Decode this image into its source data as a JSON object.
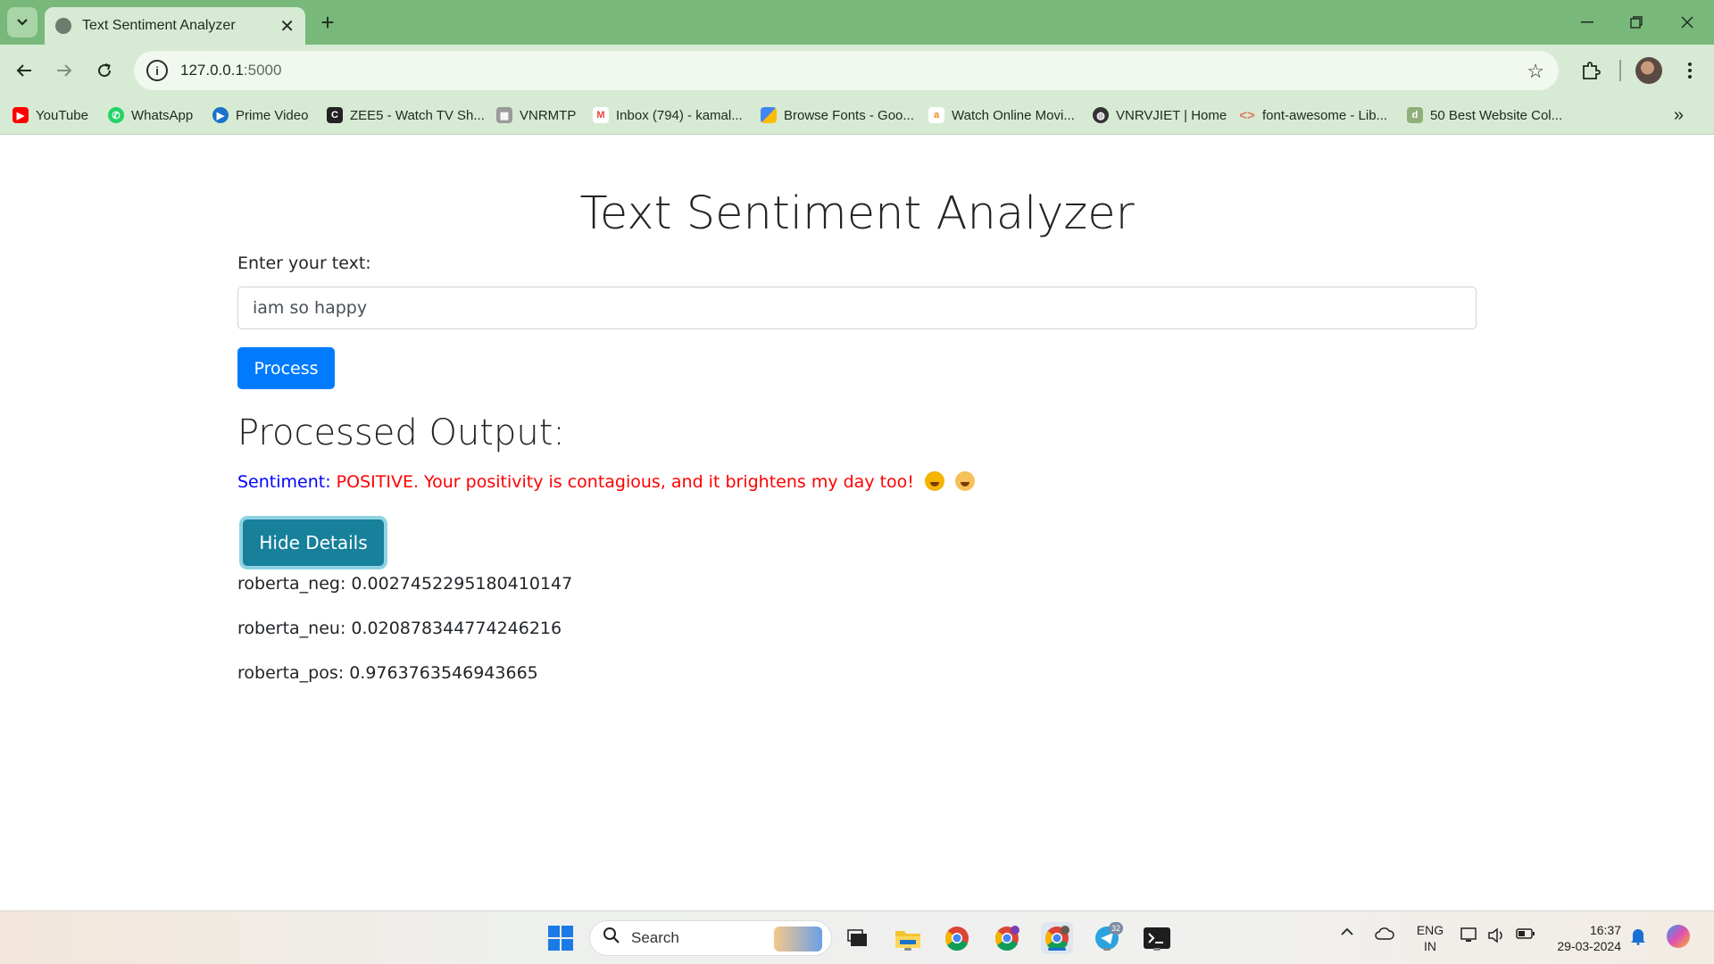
{
  "browser": {
    "tab_title": "Text Sentiment Analyzer",
    "url_host": "127.0.0.1",
    "url_port": ":5000",
    "bookmarks": [
      {
        "label": "YouTube",
        "color": "#ff0000"
      },
      {
        "label": "WhatsApp",
        "color": "#25d366"
      },
      {
        "label": "Prime Video",
        "color": "#1a73c8"
      },
      {
        "label": "ZEE5 - Watch TV Sh...",
        "color": "#222222"
      },
      {
        "label": "VNRMTP",
        "color": "#8a8a8a"
      },
      {
        "label": "Inbox (794) - kamal...",
        "color": "#ea4335"
      },
      {
        "label": "Browse Fonts - Goo...",
        "color": "#4285f4"
      },
      {
        "label": "Watch Online Movi...",
        "color": "#f08a24"
      },
      {
        "label": "VNRVJIET | Home",
        "color": "#333333"
      },
      {
        "label": "font-awesome - Lib...",
        "color": "#e07a5f"
      },
      {
        "label": "50 Best Website Col...",
        "color": "#8fb07a"
      }
    ]
  },
  "page": {
    "title": "Text Sentiment Analyzer",
    "input_label": "Enter your text:",
    "input_value": "iam so happy",
    "process_button": "Process",
    "output_heading": "Processed Output:",
    "sentiment_label": "Sentiment:",
    "sentiment_value": "POSITIVE. Your positivity is contagious, and it brightens my day too!",
    "hide_button": "Hide Details",
    "details": [
      {
        "text": "roberta_neg: 0.0027452295180410147"
      },
      {
        "text": "roberta_neu: 0.020878344774246216"
      },
      {
        "text": "roberta_pos: 0.9763763546943665"
      }
    ]
  },
  "taskbar": {
    "search_placeholder": "Search",
    "lang_top": "ENG",
    "lang_bottom": "IN",
    "time": "16:37",
    "date": "29-03-2024",
    "telegram_badge": "32"
  }
}
